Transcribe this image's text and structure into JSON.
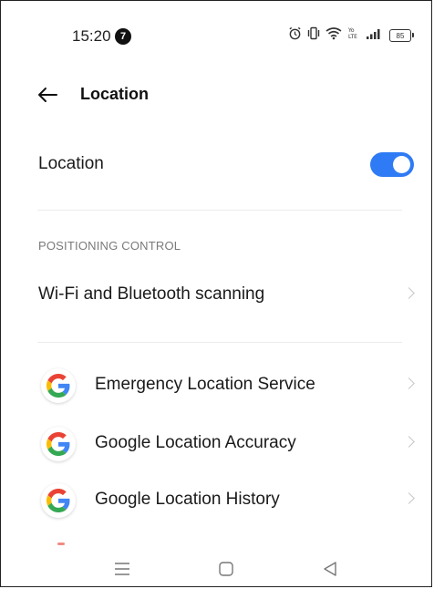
{
  "status_bar": {
    "time": "15:20",
    "notification_count": "7",
    "battery": "85",
    "icons": [
      "alarm-icon",
      "vibrate-icon",
      "wifi-icon",
      "volte-icon",
      "signal-icon",
      "battery-icon"
    ]
  },
  "header": {
    "title": "Location",
    "back_icon": "back-arrow-icon"
  },
  "location_toggle": {
    "label": "Location",
    "enabled": true,
    "accent_color": "#2f7bf5"
  },
  "positioning": {
    "section_title": "POSITIONING CONTROL",
    "wifi_bt_label": "Wi-Fi and Bluetooth scanning"
  },
  "google_services": [
    {
      "label": "Emergency Location Service",
      "icon": "google-icon"
    },
    {
      "label": "Google Location Accuracy",
      "icon": "google-icon"
    },
    {
      "label": "Google Location History",
      "icon": "google-icon"
    }
  ],
  "nav_bar": {
    "buttons": [
      "menu-icon",
      "home-icon",
      "back-triangle-icon"
    ]
  }
}
